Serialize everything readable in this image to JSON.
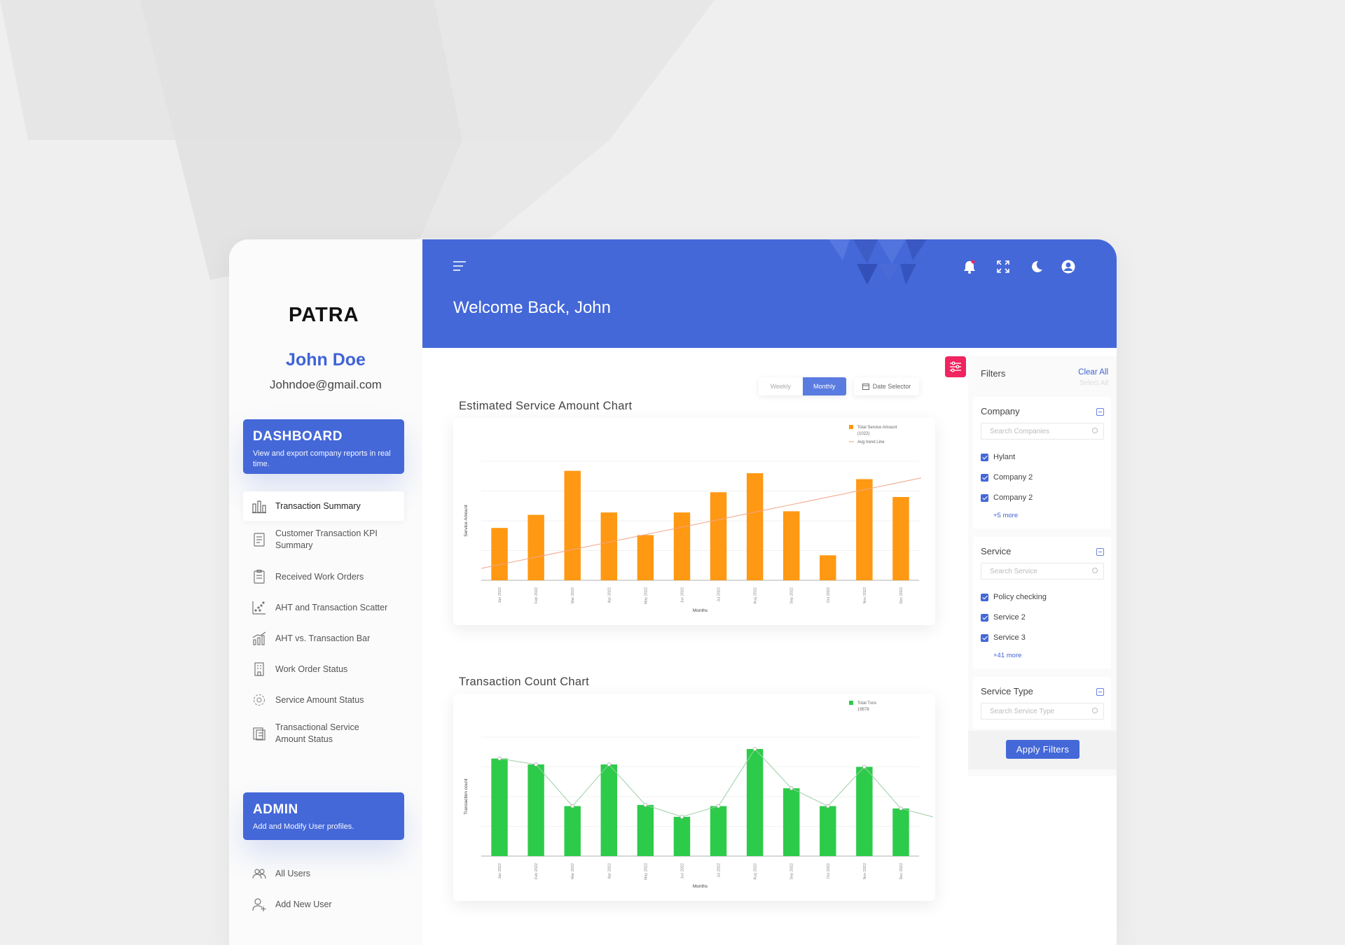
{
  "brand": {
    "logo_text": "PATRA"
  },
  "user": {
    "name": "John Doe",
    "email": "Johndoe@gmail.com"
  },
  "sections": {
    "dashboard": {
      "title": "DASHBOARD",
      "subtitle": "View and export company reports in real time."
    },
    "admin": {
      "title": "ADMIN",
      "subtitle": "Add and Modify User profiles."
    }
  },
  "nav": [
    {
      "label": "Transaction Summary",
      "icon": "bar-chart-icon",
      "active": true
    },
    {
      "label": "Customer Transaction KPI Summary",
      "icon": "document-icon"
    },
    {
      "label": "Received Work Orders",
      "icon": "clipboard-icon"
    },
    {
      "label": "AHT and Transaction Scatter",
      "icon": "scatter-icon"
    },
    {
      "label": "AHT vs. Transaction Bar",
      "icon": "bar-trend-icon"
    },
    {
      "label": "Work Order Status",
      "icon": "building-icon"
    },
    {
      "label": "Service Amount Status",
      "icon": "gear-icon"
    },
    {
      "label": "Transactional Service Amount Status",
      "icon": "report-icon"
    }
  ],
  "admin_nav": [
    {
      "label": "All Users",
      "icon": "users-icon"
    },
    {
      "label": "Add New User",
      "icon": "add-user-icon"
    }
  ],
  "header": {
    "welcome": "Welcome Back, John",
    "icons": [
      "menu-icon",
      "bell-icon",
      "fullscreen-icon",
      "moon-icon",
      "account-icon"
    ]
  },
  "toggle": {
    "weekly": "Weekly",
    "monthly": "Monthly",
    "selected": "Monthly"
  },
  "date_selector": {
    "label": "Date Selector"
  },
  "charts": {
    "service": {
      "title": "Estimated Service Amount Chart"
    },
    "transactions": {
      "title": "Transaction Count Chart"
    }
  },
  "colors": {
    "primary": "#4468d8",
    "orange": "#ff9812",
    "green": "#2dcb4a",
    "pink": "#f0245f"
  },
  "chart_data": [
    {
      "type": "bar",
      "title": "Estimated Service Amount Chart",
      "xlabel": "Months",
      "ylabel": "Service Amount",
      "categories": [
        "Jan 2022",
        "Feb 2022",
        "Mar 2022",
        "Apr 2022",
        "May 2022",
        "Jun 2022",
        "Jul 2022",
        "Aug 2022",
        "Sep 2022",
        "Oct 2022",
        "Nov 2022",
        "Dec 2022"
      ],
      "series": [
        {
          "name": "Total Service Amount (1022)",
          "values": [
            44,
            55,
            92,
            57,
            38,
            57,
            74,
            90,
            58,
            21,
            85,
            70
          ],
          "color": "#ff9812"
        }
      ],
      "trend": {
        "name": "Avg trend Line",
        "values": [
          10,
          86
        ],
        "color": "#f2a58a"
      },
      "ylim": [
        0,
        100
      ],
      "legend": "top-right"
    },
    {
      "type": "bar",
      "title": "Transaction Count Chart",
      "xlabel": "Months",
      "ylabel": "Transaction count",
      "categories": [
        "Jan 2022",
        "Feb 2022",
        "Mar 2022",
        "Apr 2022",
        "May 2022",
        "Jun 2022",
        "Jul 2022",
        "Aug 2022",
        "Sep 2022",
        "Oct 2022",
        "Nov 2022",
        "Dec 2022"
      ],
      "series": [
        {
          "name": "Total Txns 19578",
          "values": [
            82,
            77,
            42,
            77,
            43,
            33,
            42,
            90,
            57,
            42,
            75,
            40
          ],
          "color": "#2dcb4a"
        }
      ],
      "ylim": [
        0,
        100
      ],
      "legend": "top-right"
    }
  ],
  "filters": {
    "title": "Filters",
    "clear_all": "Clear All",
    "select_all": "Select All",
    "company": {
      "title": "Company",
      "placeholder": "Search Companies",
      "items": [
        "Hylant",
        "Company 2",
        "Company 2"
      ],
      "more": "+5 more"
    },
    "service": {
      "title": "Service",
      "placeholder": "Search Service",
      "items": [
        "Policy checking",
        "Service 2",
        "Service 3"
      ],
      "more": "+41 more"
    },
    "service_type": {
      "title": "Service Type",
      "placeholder": "Search Service Type"
    },
    "apply": "Apply Filters"
  }
}
